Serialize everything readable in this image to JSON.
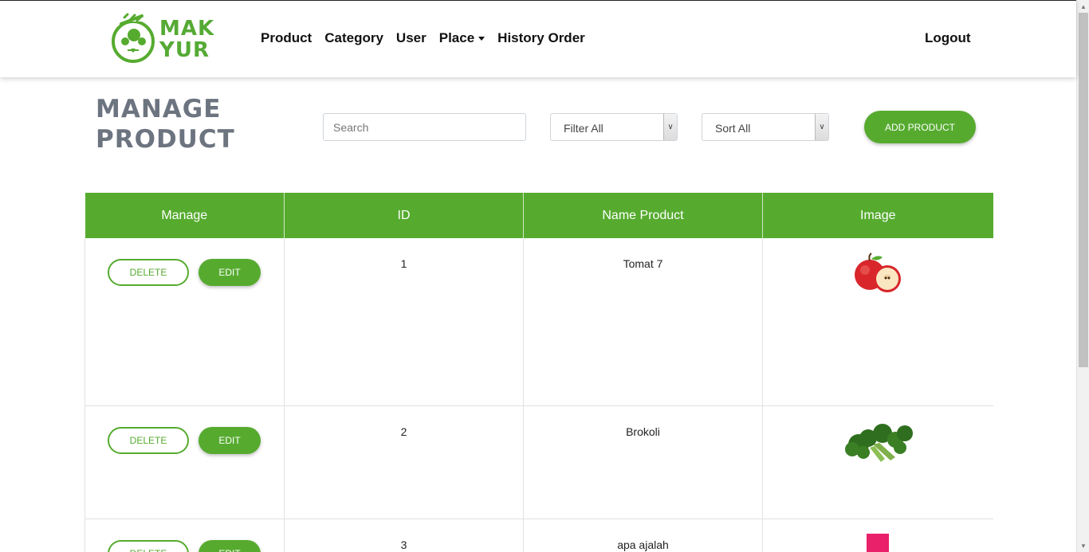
{
  "brand": {
    "logo_line1": "MAK",
    "logo_line2": "YUR",
    "color": "#56ab2f"
  },
  "nav": {
    "items": [
      {
        "label": "Product"
      },
      {
        "label": "Category"
      },
      {
        "label": "User"
      },
      {
        "label": "Place",
        "dropdown": true
      },
      {
        "label": "History Order"
      }
    ],
    "logout_label": "Logout"
  },
  "header": {
    "title_line1": "MANAGE",
    "title_line2": "PRODUCT",
    "search_placeholder": "Search",
    "filter_value": "Filter All",
    "sort_value": "Sort All",
    "add_button": "ADD PRODUCT"
  },
  "table": {
    "columns": [
      "Manage",
      "ID",
      "Name Product",
      "Image"
    ],
    "delete_label": "DELETE",
    "edit_label": "EDIT",
    "rows": [
      {
        "id": "1",
        "name": "Tomat 7",
        "image": "apple"
      },
      {
        "id": "2",
        "name": "Brokoli",
        "image": "broccoli"
      },
      {
        "id": "3",
        "name": "apa ajalah",
        "image": "pink-square"
      }
    ]
  }
}
